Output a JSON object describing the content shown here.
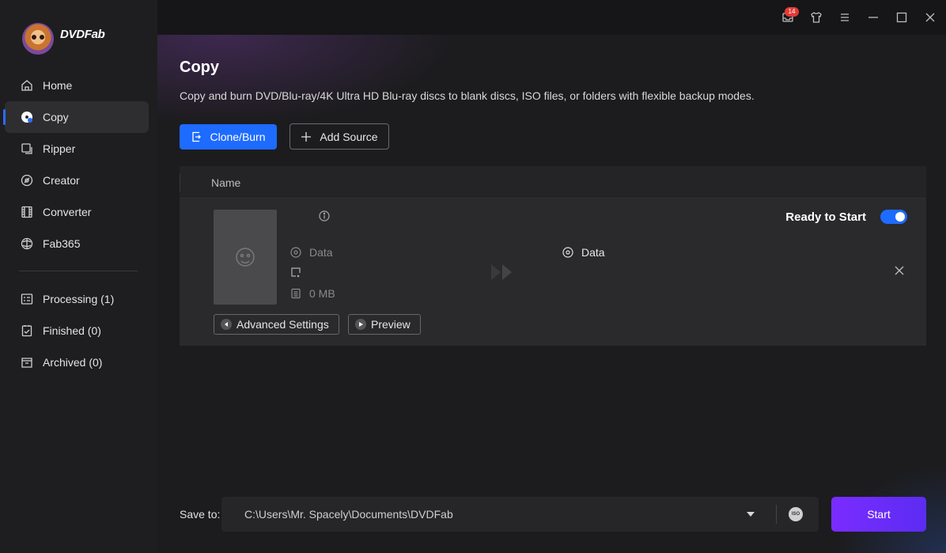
{
  "app": {
    "logo_text": "DVDFab"
  },
  "titlebar": {
    "notification_count": "14"
  },
  "sidebar": {
    "items": [
      {
        "label": "Home",
        "icon": "home-icon"
      },
      {
        "label": "Copy",
        "icon": "disc-copy-icon",
        "active": true
      },
      {
        "label": "Ripper",
        "icon": "ripper-icon"
      },
      {
        "label": "Creator",
        "icon": "creator-icon"
      },
      {
        "label": "Converter",
        "icon": "film-icon"
      },
      {
        "label": "Fab365",
        "icon": "fab365-icon"
      }
    ],
    "queue": [
      {
        "label": "Processing (1)",
        "icon": "processing-icon"
      },
      {
        "label": "Finished (0)",
        "icon": "finished-icon"
      },
      {
        "label": "Archived (0)",
        "icon": "archived-icon"
      }
    ]
  },
  "main": {
    "title": "Copy",
    "description": "Copy and burn DVD/Blu-ray/4K Ultra HD Blu-ray discs to blank discs, ISO files, or folders with flexible backup modes.",
    "clone_burn_label": "Clone/Burn",
    "add_source_label": "Add Source",
    "table": {
      "name_header": "Name",
      "row": {
        "source_type": "Data",
        "size": "0 MB",
        "output_type": "Data",
        "status": "Ready to Start",
        "advanced_settings_label": "Advanced Settings",
        "preview_label": "Preview"
      }
    }
  },
  "bottom": {
    "save_to_label": "Save to:",
    "save_path": "C:\\Users\\Mr. Spacely\\Documents\\DVDFab",
    "iso_label": "ISO",
    "start_label": "Start"
  },
  "colors": {
    "accent_blue": "#1e6bff",
    "start_purple": "#7a2cff",
    "badge_red": "#e53935"
  }
}
